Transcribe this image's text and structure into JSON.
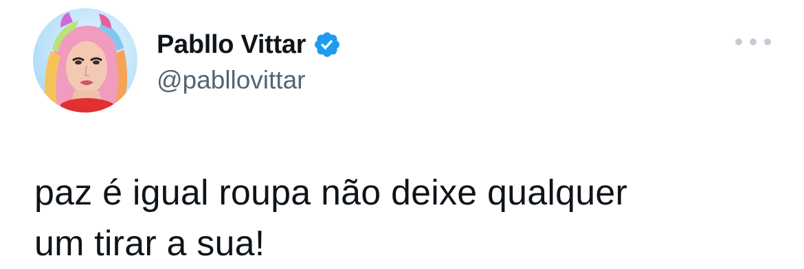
{
  "tweet": {
    "author": {
      "display_name": "Pabllo Vittar",
      "handle": "@pabllovittar",
      "verified": true
    },
    "text": "paz é igual roupa não deixe qualquer\num tirar a sua!",
    "icons": {
      "verified": "verified-badge-icon",
      "more": "more-options-icon"
    },
    "colors": {
      "verified_badge": "#1d9bf0",
      "handle_text": "#536471",
      "body_text": "#0f1419",
      "more_dots": "#c4cdd5"
    }
  }
}
